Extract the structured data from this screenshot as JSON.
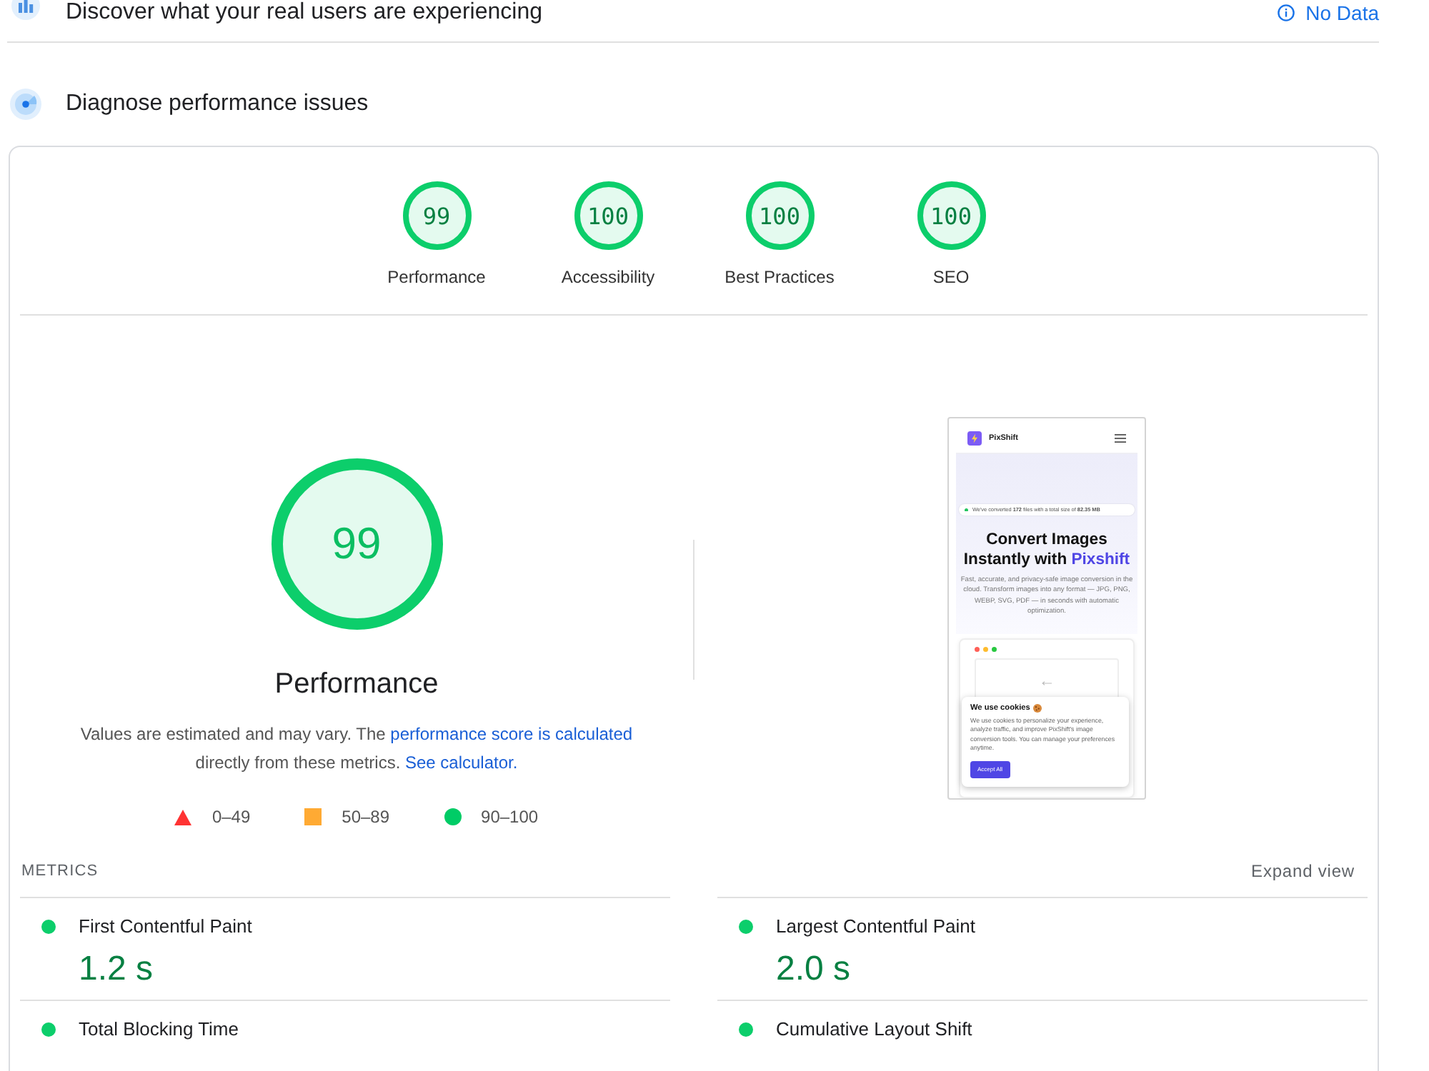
{
  "field_data": {
    "title": "Discover what your real users are experiencing",
    "status": "No Data"
  },
  "diagnose": {
    "title": "Diagnose performance issues"
  },
  "category_gauges": [
    {
      "score": "99",
      "label": "Performance",
      "color": "#0cce6b"
    },
    {
      "score": "100",
      "label": "Accessibility",
      "color": "#0cce6b"
    },
    {
      "score": "100",
      "label": "Best Practices",
      "color": "#0cce6b"
    },
    {
      "score": "100",
      "label": "SEO",
      "color": "#0cce6b"
    }
  ],
  "performance": {
    "score": "99",
    "color": "#0cce6b",
    "title": "Performance",
    "note": [
      {
        "kind": "text",
        "text": "Values are estimated and may vary. The "
      },
      {
        "kind": "link",
        "text": "performance score is calculated"
      },
      {
        "kind": "text",
        "text": " directly from these metrics. "
      },
      {
        "kind": "link",
        "text": "See calculator."
      }
    ]
  },
  "legend": [
    {
      "kind": "triangle",
      "color": "#ff3333",
      "label": "0–49"
    },
    {
      "kind": "square",
      "color": "#ffaa33",
      "label": "50–89"
    },
    {
      "kind": "circle",
      "color": "#00cc66",
      "label": "90–100"
    }
  ],
  "screenshot": {
    "brand": "PixShift",
    "badge": "We've converted **172** files with a total size of **82.35 MB**",
    "headline_lines": [
      "Convert Images",
      "Instantly with"
    ],
    "headline_highlight": "Pixshift",
    "description": "Fast, accurate, and privacy-safe image conversion in the cloud. Transform images into any format — JPG, PNG, WEBP, SVG, PDF — in seconds with automatic optimization.",
    "cookie_title": "We use cookies",
    "cookie_text": "We use cookies to personalize your experience, analyze traffic, and improve PixShift's image conversion tools. You can manage your preferences anytime.",
    "cookie_button": "Accept All"
  },
  "metrics": {
    "title": "METRICS",
    "toggle": "Expand view",
    "items": [
      {
        "label": "First Contentful Paint",
        "value": "1.2 s",
        "color": "#0cce6b"
      },
      {
        "label": "Largest Contentful Paint",
        "value": "2.0 s",
        "color": "#0cce6b"
      },
      {
        "label": "Total Blocking Time",
        "color": "#0cce6b"
      },
      {
        "label": "Cumulative Layout Shift",
        "color": "#0cce6b"
      }
    ]
  }
}
